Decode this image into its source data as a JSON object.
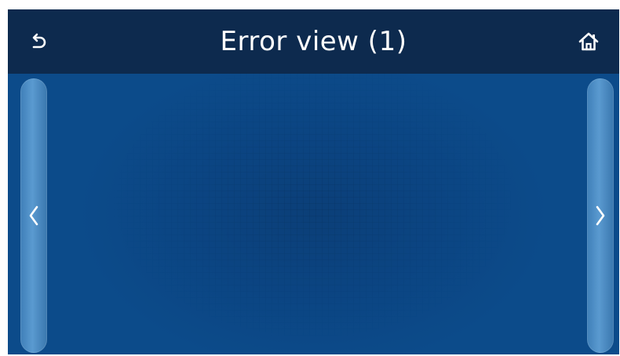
{
  "header": {
    "title": "Error view (1)",
    "back_icon": "back-arrow-icon",
    "home_icon": "home-icon"
  },
  "nav": {
    "prev_icon": "chevron-left-icon",
    "next_icon": "chevron-right-icon"
  },
  "colors": {
    "header_bg": "#0d2a4e",
    "content_bg": "#0a4a86",
    "side_button": "#4d8cc4",
    "text": "#ffffff"
  }
}
